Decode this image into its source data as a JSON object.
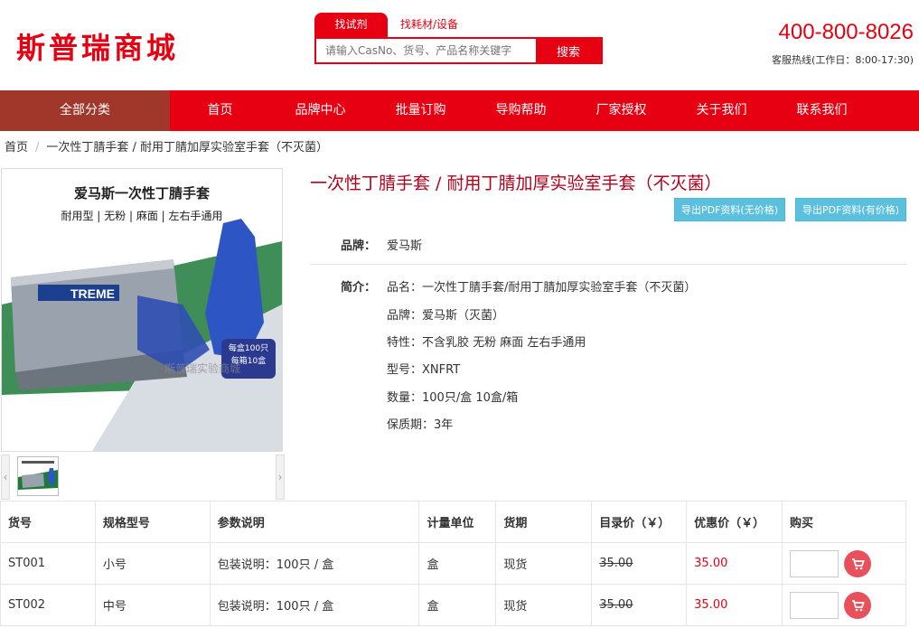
{
  "header": {
    "logo": "斯普瑞商城",
    "search_tabs": [
      "找试剂",
      "找耗材/设备"
    ],
    "search_placeholder": "请输入CasNo、货号、产品名称关键字",
    "search_button": "搜索",
    "hotline": "400-800-8026",
    "hotline_sub": "客服热线(工作日：8:00-17:30)"
  },
  "nav": {
    "all": "全部分类",
    "items": [
      "首页",
      "品牌中心",
      "批量订购",
      "导购帮助",
      "厂家授权",
      "关于我们",
      "联系我们"
    ]
  },
  "breadcrumb": {
    "home": "首页",
    "current": "一次性丁腈手套 / 耐用丁腈加厚实验室手套（不灭菌）"
  },
  "gallery": {
    "img_title": "爱马斯一次性丁腈手套",
    "img_sub": "耐用型 | 无粉 | 麻面 | 左右手通用",
    "box_brand": "TREME",
    "badge_line1": "每盒100只",
    "badge_line2": "每箱10盒",
    "watermark": "斯普瑞实验商城",
    "prev": "‹",
    "next": "›"
  },
  "product": {
    "title": "一次性丁腈手套 / 耐用丁腈加厚实验室手套（不灭菌）",
    "pdf_no_price": "导出PDF资料(无价格)",
    "pdf_price": "导出PDF资料(有价格)",
    "brand_label": "品牌：",
    "brand": "爱马斯",
    "intro_label": "简介：",
    "intro": [
      "品名：一次性丁腈手套/耐用丁腈加厚实验室手套（不灭菌）",
      "品牌：爱马斯（灭菌）",
      "特性：不含乳胶 无粉 麻面 左右手通用",
      "型号：XNFRT",
      "数量：100只/盒 10盒/箱",
      "保质期：3年"
    ]
  },
  "table": {
    "headers": [
      "货号",
      "规格型号",
      "参数说明",
      "计量单位",
      "货期",
      "目录价（￥）",
      "优惠价（￥）",
      "购买"
    ],
    "rows": [
      {
        "sku": "ST001",
        "spec": "小号",
        "param": "包装说明：100只 / 盒",
        "unit": "盒",
        "lead": "现货",
        "list": "35.00",
        "sale": "35.00"
      },
      {
        "sku": "ST002",
        "spec": "中号",
        "param": "包装说明：100只 / 盒",
        "unit": "盒",
        "lead": "现货",
        "list": "35.00",
        "sale": "35.00"
      }
    ]
  },
  "colors": {
    "brand_red": "#e60012",
    "nav_all": "#a1372b",
    "pdf_blue": "#5bc0de"
  }
}
